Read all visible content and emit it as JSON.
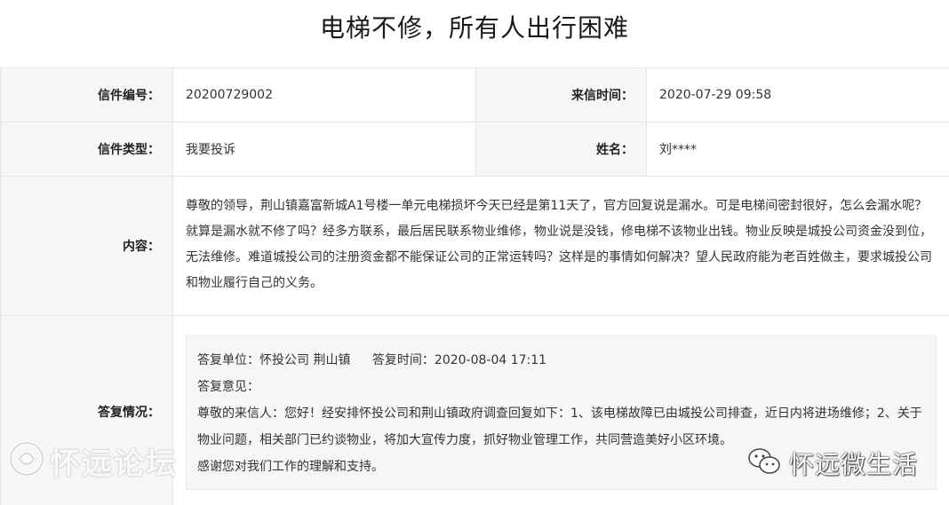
{
  "title": "电梯不修，所有人出行困难",
  "fields": {
    "letter_no_label": "信件编号：",
    "letter_no_value": "20200729002",
    "time_label": "来信时间：",
    "time_value": "2020-07-29 09:58",
    "type_label": "信件类型：",
    "type_value": "我要投诉",
    "name_label": "姓名：",
    "name_value": "刘****",
    "content_label": "内容：",
    "content_value": "尊敬的领导，荆山镇嘉富新城A1号楼一单元电梯损坏今天已经是第11天了，官方回复说是漏水。可是电梯间密封很好，怎么会漏水呢？就算是漏水就不修了吗？经多方联系，最后居民联系物业维修，物业说是没钱，修电梯不该物业出钱。物业反映是城投公司资金没到位，无法维修。难道城投公司的注册资金都不能保证公司的正常运转吗？这样是的事情如何解决？望人民政府能为老百姓做主，要求城投公司和物业履行自己的义务。",
    "reply_label": "答复情况："
  },
  "reply": {
    "unit": "答复单位：怀投公司 荆山镇",
    "time": "答复时间：2020-08-04 17:11",
    "opinion_label": "答复意见：",
    "line1": "尊敬的来信人：您好！经安排怀投公司和荆山镇政府调查回复如下：1、该电梯故障已由城投公司排查，近日内将进场维修；2、关于物业问题，相关部门已约谈物业，将加大宣传力度，抓好物业管理工作，共同营造美好小区环境。",
    "line2": "感谢您对我们工作的理解和支持。"
  },
  "watermarks": {
    "left_text": "怀远论坛",
    "right_text": "怀远微生活",
    "left_logo_icon": "forum-logo-icon",
    "right_logo_icon": "wechat-logo-icon"
  }
}
